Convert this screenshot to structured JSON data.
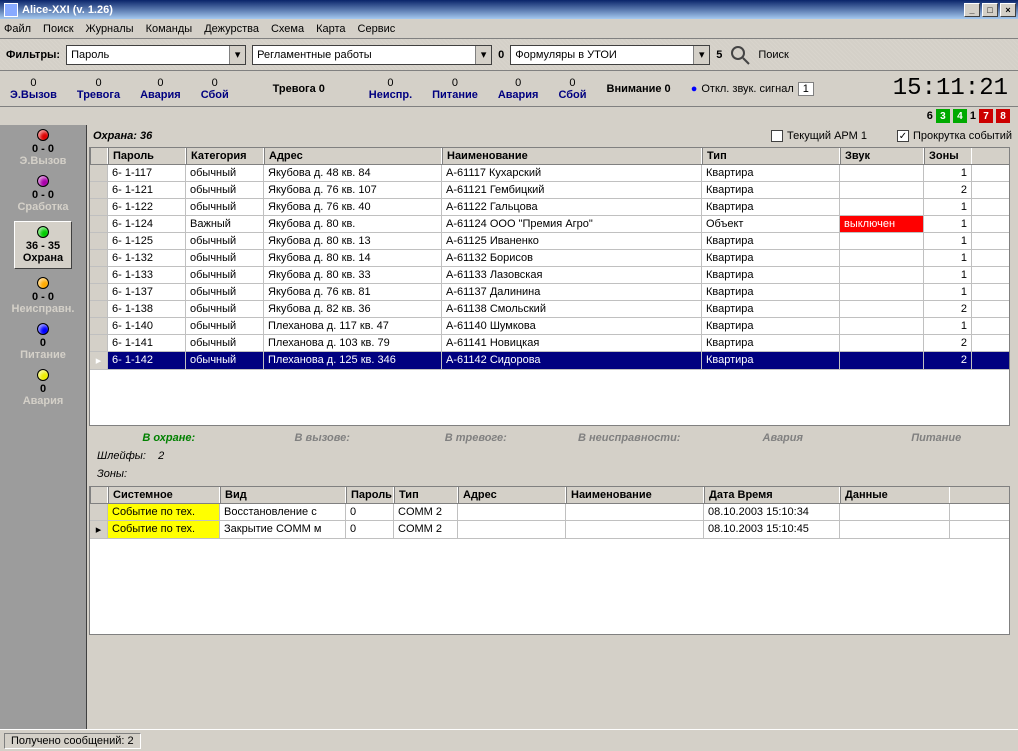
{
  "window": {
    "title": "Alice-XXI (v. 1.26)"
  },
  "menu": [
    "Файл",
    "Поиск",
    "Журналы",
    "Команды",
    "Дежурства",
    "Схема",
    "Карта",
    "Сервис"
  ],
  "filter": {
    "label": "Фильтры:",
    "combo1": "Пароль",
    "combo2": "Регламентные работы",
    "count2": "0",
    "combo3": "Формуляры в УТОИ",
    "count3": "5",
    "search": "Поиск"
  },
  "status": {
    "cells": [
      {
        "n": "0",
        "l": "Э.Вызов"
      },
      {
        "n": "0",
        "l": "Тревога"
      },
      {
        "n": "0",
        "l": "Авария"
      },
      {
        "n": "0",
        "l": "Сбой"
      }
    ],
    "alarm_label": "Тревога 0",
    "cells2": [
      {
        "n": "0",
        "l": "Неиспр."
      },
      {
        "n": "0",
        "l": "Питание"
      },
      {
        "n": "0",
        "l": "Авария"
      },
      {
        "n": "0",
        "l": "Сбой"
      }
    ],
    "attention": "Внимание 0",
    "sound": "Откл. звук. сигнал",
    "sound_n": "1",
    "time": "15:11:21"
  },
  "indicators": [
    "6",
    "3",
    "4",
    "1",
    "7",
    "8"
  ],
  "sidebar": [
    {
      "color": "#d00",
      "n": "0 - 0",
      "l": "Э.Вызов"
    },
    {
      "color": "#a0a",
      "n": "0 - 0",
      "l": "Сработка"
    },
    {
      "color": "#0c0",
      "n": "36 - 35",
      "l": "Охрана",
      "active": true
    },
    {
      "color": "#fa0",
      "n": "0 - 0",
      "l": "Неисправн."
    },
    {
      "color": "#00f",
      "n": "0",
      "l": "Питание"
    },
    {
      "color": "#ee0",
      "n": "0",
      "l": "Авария"
    }
  ],
  "ohrana": "Охрана: 36",
  "arm": "Текущий АРМ 1",
  "scroll": "Прокрутка событий",
  "columns": [
    "Пароль",
    "Категория",
    "Адрес",
    "Наименование",
    "Тип",
    "Звук",
    "Зоны"
  ],
  "rows": [
    {
      "p": "6- 1-117",
      "k": "обычный",
      "a": "Якубова д. 48 кв. 84",
      "n": "А-61117 Кухарский",
      "t": "Квартира",
      "s": "",
      "z": "1"
    },
    {
      "p": "6- 1-121",
      "k": "обычный",
      "a": "Якубова д. 76 кв. 107",
      "n": "А-61121 Гембицкий",
      "t": "Квартира",
      "s": "",
      "z": "2"
    },
    {
      "p": "6- 1-122",
      "k": "обычный",
      "a": "Якубова д. 76 кв. 40",
      "n": "А-61122 Гальцова",
      "t": "Квартира",
      "s": "",
      "z": "1"
    },
    {
      "p": "6- 1-124",
      "k": "Важный",
      "a": "Якубова д. 80 кв.",
      "n": "А-61124 ООО \"Премия Агро\"",
      "t": "Объект",
      "s": "выключен",
      "z": "1",
      "red": true
    },
    {
      "p": "6- 1-125",
      "k": "обычный",
      "a": "Якубова д. 80 кв. 13",
      "n": "А-61125 Иваненко",
      "t": "Квартира",
      "s": "",
      "z": "1"
    },
    {
      "p": "6- 1-132",
      "k": "обычный",
      "a": "Якубова д. 80 кв. 14",
      "n": "А-61132 Борисов",
      "t": "Квартира",
      "s": "",
      "z": "1"
    },
    {
      "p": "6- 1-133",
      "k": "обычный",
      "a": "Якубова д. 80 кв. 33",
      "n": "А-61133 Лазовская",
      "t": "Квартира",
      "s": "",
      "z": "1"
    },
    {
      "p": "6- 1-137",
      "k": "обычный",
      "a": "Якубова д. 76 кв. 81",
      "n": "А-61137 Далинина",
      "t": "Квартира",
      "s": "",
      "z": "1"
    },
    {
      "p": "6- 1-138",
      "k": "обычный",
      "a": "Якубова д. 82 кв. 36",
      "n": "А-61138 Смольский",
      "t": "Квартира",
      "s": "",
      "z": "2"
    },
    {
      "p": "6- 1-140",
      "k": "обычный",
      "a": "Плеханова д. 117 кв. 47",
      "n": "А-61140 Шумкова",
      "t": "Квартира",
      "s": "",
      "z": "1"
    },
    {
      "p": "6- 1-141",
      "k": "обычный",
      "a": "Плеханова д. 103 кв. 79",
      "n": "А-61141 Новицкая",
      "t": "Квартира",
      "s": "",
      "z": "2"
    },
    {
      "p": "6- 1-142",
      "k": "обычный",
      "a": "Плеханова д. 125 кв. 346",
      "n": "А-61142 Сидорова",
      "t": "Квартира",
      "s": "",
      "z": "2",
      "sel": true
    }
  ],
  "band": [
    "В охране:",
    "В вызове:",
    "В тревоге:",
    "В неисправности:",
    "Авария",
    "Питание"
  ],
  "shleif": {
    "k": "Шлейфы:",
    "v": "2"
  },
  "zony": {
    "k": "Зоны:"
  },
  "cols2": [
    "Системное",
    "Вид",
    "Пароль",
    "Тип",
    "Адрес",
    "Наименование",
    "Дата Время",
    "Данные"
  ],
  "rows2": [
    {
      "s": "Событие по тех.",
      "v": "Восстановление с",
      "p": "0",
      "t": "COMM 2",
      "a": "",
      "n": "",
      "d": "08.10.2003 15:10:34",
      "da": ""
    },
    {
      "s": "Событие по тех.",
      "v": "Закрытие COMM м",
      "p": "0",
      "t": "COMM 2",
      "a": "",
      "n": "",
      "d": "08.10.2003 15:10:45",
      "da": ""
    }
  ],
  "footer": "Получено сообщений: 2"
}
